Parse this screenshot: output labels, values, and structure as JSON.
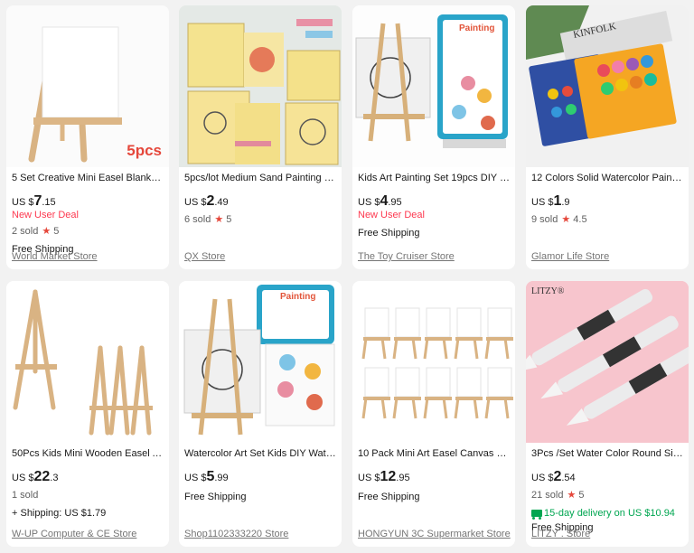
{
  "cards": [
    {
      "title": "5 Set Creative Mini Easel Blank Ca...",
      "price_prefix": "US $",
      "price_int": "7",
      "price_dec": ".15",
      "deal": "New User Deal",
      "sold": "2 sold",
      "rating": "5",
      "shipping": "Free Shipping",
      "store": "World Market Store",
      "image_badge": "5pcs",
      "image": "blank-canvas-on-easel"
    },
    {
      "title": "5pcs/lot Medium Sand Painting Ea...",
      "price_prefix": "US $",
      "price_int": "2",
      "price_dec": ".49",
      "sold": "6 sold",
      "rating": "5",
      "store": "QX Store",
      "image": "sand-painting-cards"
    },
    {
      "title": "Kids Art Painting Set 19pcs DIY Wa...",
      "price_prefix": "US $",
      "price_int": "4",
      "price_dec": ".95",
      "deal": "New User Deal",
      "shipping": "Free Shipping",
      "store": "The Toy Cruiser Store",
      "image": "kids-painting-set",
      "image_text": "Painting"
    },
    {
      "title": "12 Colors Solid Watercolor Paints ...",
      "price_prefix": "US $",
      "price_int": "1",
      "price_dec": ".9",
      "sold": "9 sold",
      "rating": "4.5",
      "store": "Glamor Life Store",
      "image": "watercolor-paint-trays",
      "image_text": "KINFOLK"
    },
    {
      "title": "50Pcs Kids Mini Wooden Easel Art ...",
      "price_prefix": "US $",
      "price_int": "22",
      "price_dec": ".3",
      "sold": "1 sold",
      "shipping": "+ Shipping: US $1.79",
      "store": "W-UP Computer & CE Store",
      "image": "wooden-easels"
    },
    {
      "title": "Watercolor Art Set Kids DIY Waterc...",
      "price_prefix": "US $",
      "price_int": "5",
      "price_dec": ".99",
      "shipping": "Free Shipping",
      "store": "Shop1102333220 Store",
      "image": "watercolor-art-set",
      "image_text": "Painting"
    },
    {
      "title": "10 Pack Mini Art Easel Canvas Set ...",
      "price_prefix": "US $",
      "price_int": "12",
      "price_dec": ".95",
      "shipping": "Free Shipping",
      "store": "HONGYUN 3C Supermarket Store",
      "image": "ten-mini-easels"
    },
    {
      "title": "3Pcs /Set Water Color Round Size ...",
      "price_prefix": "US $",
      "price_int": "2",
      "price_dec": ".54",
      "sold": "21 sold",
      "rating": "5",
      "delivery": "15-day delivery on US $10.94",
      "shipping": "Free Shipping",
      "store": "LITZY . Store",
      "image": "water-brush-pens",
      "image_text": "LITZY®"
    }
  ],
  "colors": {
    "accent_red": "#fd384f",
    "star": "#e5473b",
    "delivery_green": "#00a651"
  }
}
